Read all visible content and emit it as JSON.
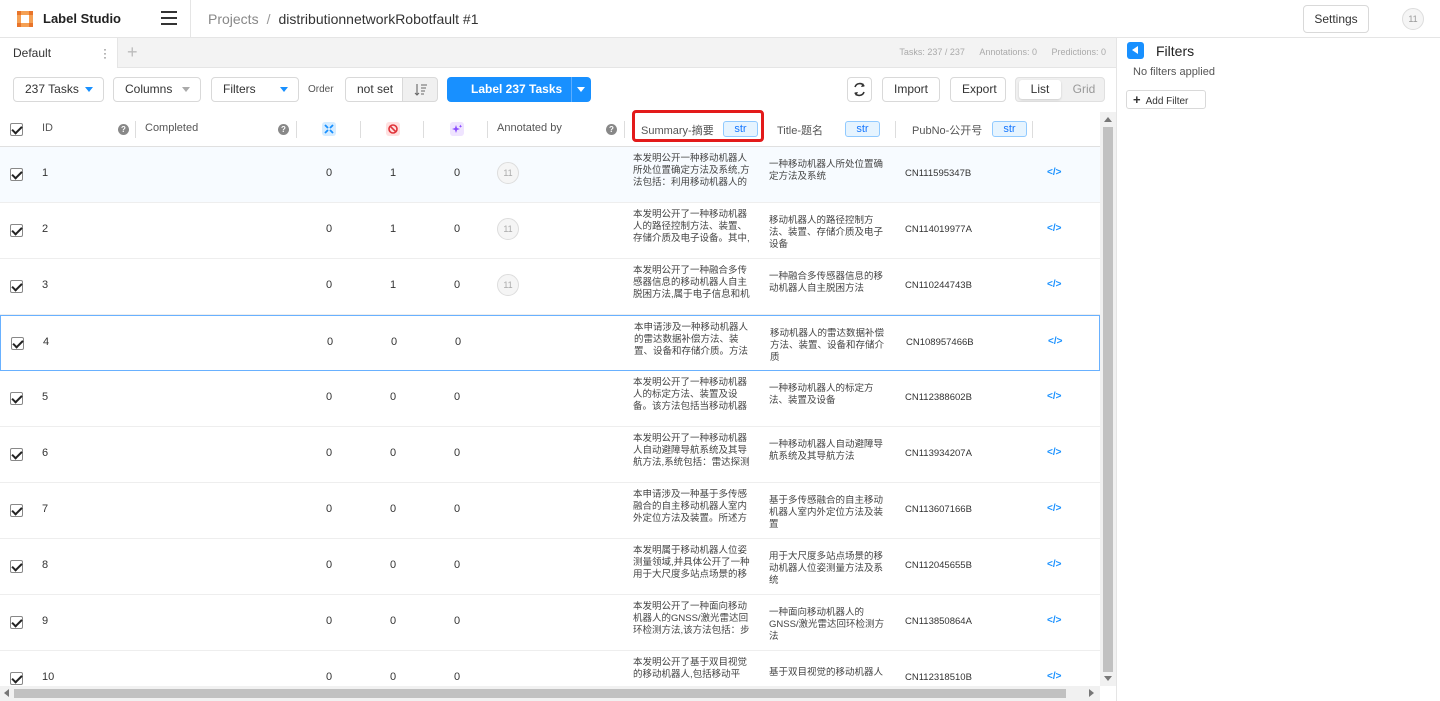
{
  "app": {
    "name": "Label Studio"
  },
  "breadcrumb": {
    "projects": "Projects",
    "separator": "/",
    "project": "distributionnetworkRobotfault #1"
  },
  "header": {
    "settings_label": "Settings",
    "user_initials": "11"
  },
  "tabs": {
    "default_label": "Default",
    "add_label": "+"
  },
  "stats": {
    "tasks": "Tasks: 237 / 237",
    "annotations": "Annotations: 0",
    "predictions": "Predictions: 0"
  },
  "toolbar": {
    "tasks_label": "237 Tasks",
    "columns_label": "Columns",
    "filters_label": "Filters",
    "order_label": "Order",
    "order_value": "not set",
    "label_button": "Label 237 Tasks",
    "import_label": "Import",
    "export_label": "Export",
    "view_list": "List",
    "view_grid": "Grid"
  },
  "columns": {
    "id": "ID",
    "completed": "Completed",
    "annotated_by": "Annotated by",
    "summary": "Summary-摘要",
    "title": "Title-题名",
    "pubno": "PubNo-公开号",
    "type_badge": "str",
    "help_glyph": "?"
  },
  "rows": [
    {
      "id": "1",
      "total": "0",
      "cancelled": "1",
      "predictions": "0",
      "annotator": "11",
      "summary": "本发明公开一种移动机器人所处位置确定方法及系统,方法包括：利用移动机器人的",
      "title": "一种移动机器人所处位置确定方法及系统",
      "pubno": "CN111595347B"
    },
    {
      "id": "2",
      "total": "0",
      "cancelled": "1",
      "predictions": "0",
      "annotator": "11",
      "summary": "本发明公开了一种移动机器人的路径控制方法、装置、存储介质及电子设备。其中,",
      "title": "移动机器人的路径控制方法、装置、存储介质及电子设备",
      "pubno": "CN114019977A"
    },
    {
      "id": "3",
      "total": "0",
      "cancelled": "1",
      "predictions": "0",
      "annotator": "11",
      "summary": "本发明公开了一种融合多传感器信息的移动机器人自主脱困方法,属于电子信息和机",
      "title": "一种融合多传感器信息的移动机器人自主脱困方法",
      "pubno": "CN110244743B"
    },
    {
      "id": "4",
      "total": "0",
      "cancelled": "0",
      "predictions": "0",
      "annotator": "",
      "summary": "本申请涉及一种移动机器人的雷达数据补偿方法、装置、设备和存储介质。方法",
      "title": "移动机器人的雷达数据补偿方法、装置、设备和存储介质",
      "pubno": "CN108957466B"
    },
    {
      "id": "5",
      "total": "0",
      "cancelled": "0",
      "predictions": "0",
      "annotator": "",
      "summary": "本发明公开了一种移动机器人的标定方法、装置及设备。该方法包括当移动机器",
      "title": "一种移动机器人的标定方法、装置及设备",
      "pubno": "CN112388602B"
    },
    {
      "id": "6",
      "total": "0",
      "cancelled": "0",
      "predictions": "0",
      "annotator": "",
      "summary": "本发明公开了一种移动机器人自动避障导航系统及其导航方法,系统包括：雷达探测",
      "title": "一种移动机器人自动避障导航系统及其导航方法",
      "pubno": "CN113934207A"
    },
    {
      "id": "7",
      "total": "0",
      "cancelled": "0",
      "predictions": "0",
      "annotator": "",
      "summary": "本申请涉及一种基于多传感融合的自主移动机器人室内外定位方法及装置。所述方",
      "title": "基于多传感融合的自主移动机器人室内外定位方法及装置",
      "pubno": "CN113607166B"
    },
    {
      "id": "8",
      "total": "0",
      "cancelled": "0",
      "predictions": "0",
      "annotator": "",
      "summary": "本发明属于移动机器人位姿测量领域,并具体公开了一种用于大尺度多站点场景的移",
      "title": "用于大尺度多站点场景的移动机器人位姿测量方法及系统",
      "pubno": "CN112045655B"
    },
    {
      "id": "9",
      "total": "0",
      "cancelled": "0",
      "predictions": "0",
      "annotator": "",
      "summary": "本发明公开了一种面向移动机器人的GNSS/激光雷达回环检测方法,该方法包括：步",
      "title": "一种面向移动机器人的GNSS/激光雷达回环检测方法",
      "pubno": "CN113850864A"
    },
    {
      "id": "10",
      "total": "0",
      "cancelled": "0",
      "predictions": "0",
      "annotator": "",
      "summary": "本发明公开了基于双目视觉的移动机器人,包括移动平",
      "title": "基于双目视觉的移动机器人",
      "pubno": "CN112318510B"
    }
  ],
  "filters_panel": {
    "title": "Filters",
    "empty": "No filters applied",
    "add_label": "Add Filter",
    "add_glyph": "+"
  },
  "colors": {
    "accent": "#1890ff",
    "highlight": "#e31a1a",
    "badge_bg": "#e6f4ff"
  },
  "icons": [
    "logo-icon",
    "menu-icon",
    "kebab-icon",
    "refresh-icon",
    "sort-icon",
    "total-annotations-icon",
    "cancelled-icon",
    "predictions-icon",
    "code-icon",
    "back-icon",
    "plus-icon"
  ]
}
